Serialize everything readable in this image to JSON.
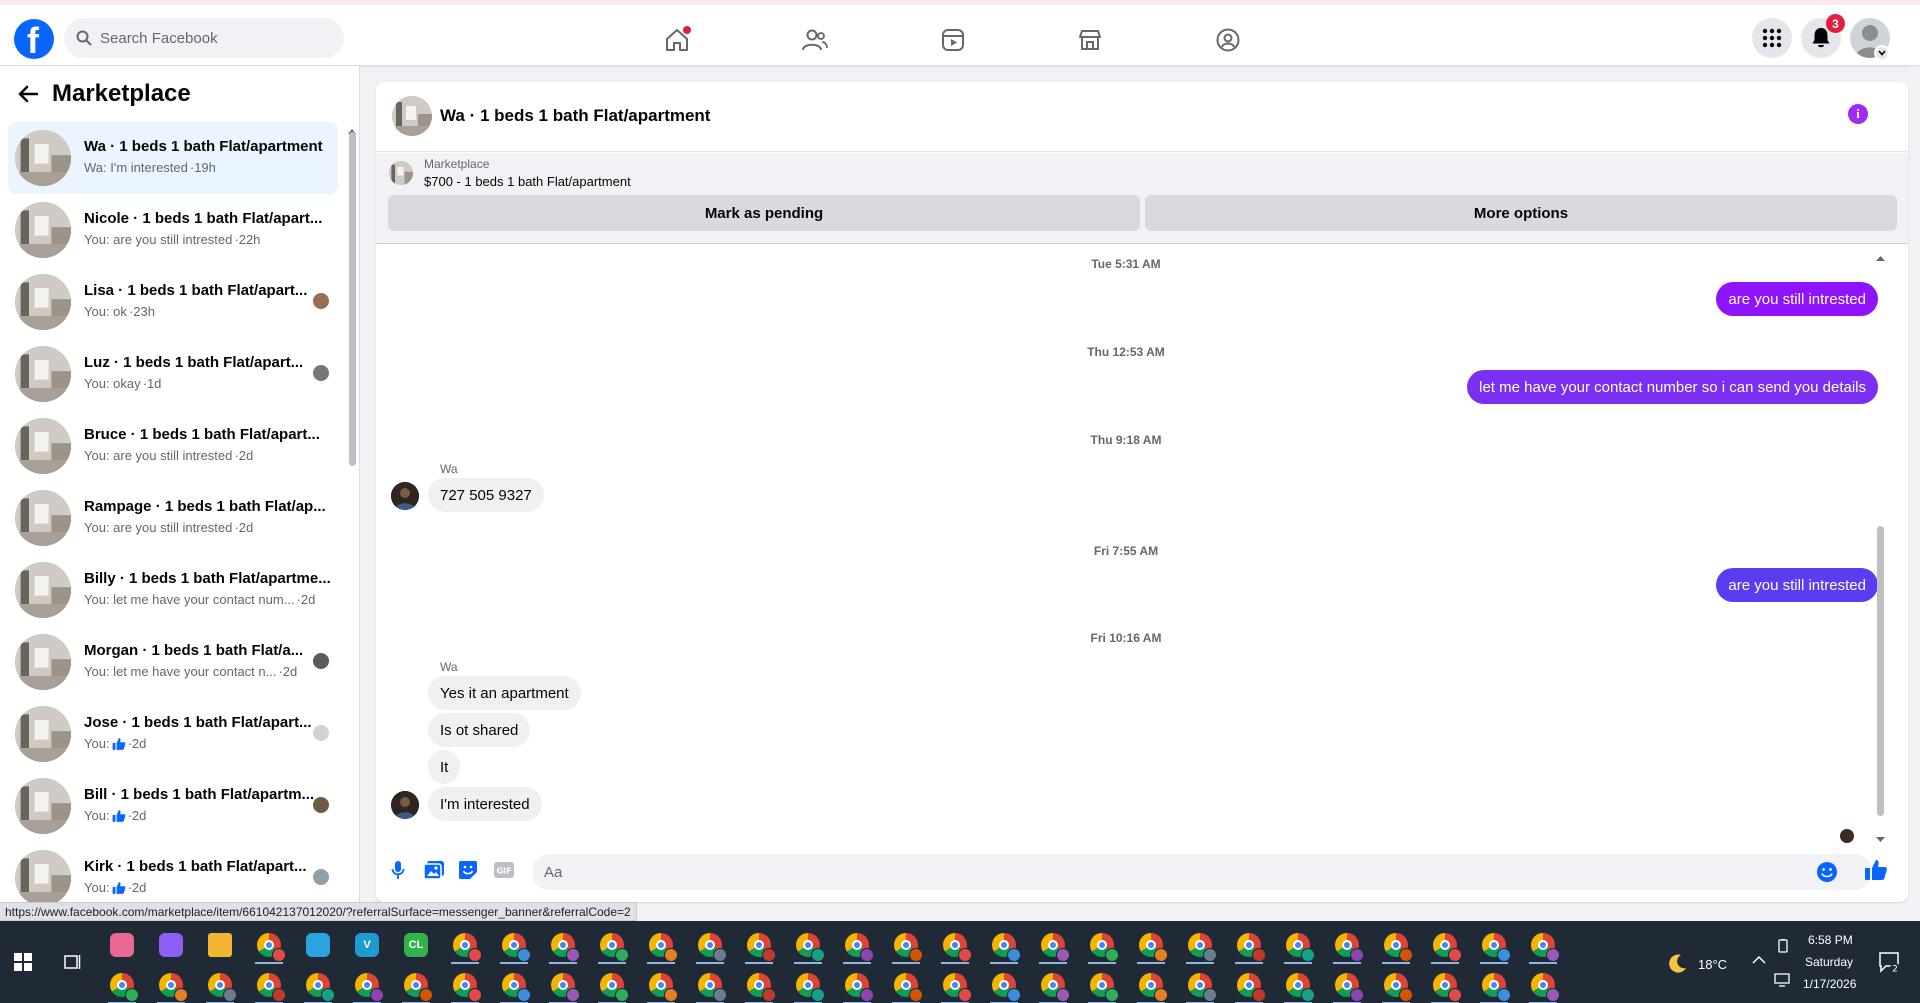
{
  "header": {
    "search_placeholder": "Search Facebook",
    "notification_count": "3"
  },
  "sidebar": {
    "title": "Marketplace",
    "conversations": [
      {
        "title": "Wa · 1 beds 1 bath Flat/apartment",
        "sub": "Wa: I'm interested",
        "time": "·19h"
      },
      {
        "title": "Nicole · 1 beds 1 bath Flat/apart...",
        "sub": "You: are you still intrested",
        "time": "·22h"
      },
      {
        "title": "Lisa · 1 beds 1 bath Flat/apart...",
        "sub": "You: ok",
        "time": "·23h"
      },
      {
        "title": "Luz · 1 beds 1 bath Flat/apart...",
        "sub": "You: okay",
        "time": "·1d"
      },
      {
        "title": "Bruce · 1 beds 1 bath Flat/apart...",
        "sub": "You: are you still intrested",
        "time": "·2d"
      },
      {
        "title": "Rampage · 1 beds 1 bath Flat/ap...",
        "sub": "You: are you still intrested",
        "time": "·2d"
      },
      {
        "title": "Billy · 1 beds 1 bath Flat/apartme...",
        "sub": "You: let me have your contact num...",
        "time": "·2d"
      },
      {
        "title": "Morgan · 1 beds 1 bath Flat/a...",
        "sub": "You: let me have your contact n...",
        "time": "·2d"
      },
      {
        "title": "Jose · 1 beds 1 bath Flat/apart...",
        "sub": "You:",
        "time": "·2d"
      },
      {
        "title": "Bill · 1 beds 1 bath Flat/apartm...",
        "sub": "You:",
        "time": "·2d"
      },
      {
        "title": "Kirk · 1 beds 1 bath Flat/apart...",
        "sub": "You:",
        "time": "·2d"
      }
    ]
  },
  "chat": {
    "title": "Wa · 1 beds 1 bath Flat/apartment",
    "marketplace_label": "Marketplace",
    "listing": "$700 - 1 beds 1 bath Flat/apartment",
    "mark_pending_label": "Mark as pending",
    "more_options_label": "More options",
    "timestamps": [
      "Tue 5:31 AM",
      "Thu 12:53 AM",
      "Thu 9:18 AM",
      "Fri 7:55 AM",
      "Fri 10:16 AM"
    ],
    "sender_name": "Wa",
    "out_messages": [
      "are you still intrested",
      "let me have your contact number so i can send you details",
      "are you still intrested"
    ],
    "in_messages": [
      "727 505 9327",
      "Yes it an apartment",
      "Is ot shared",
      "It",
      "I'm interested"
    ],
    "composer_placeholder": "Aa"
  },
  "status_url": "https://www.facebook.com/marketplace/item/661042137012020/?referralSurface=messenger_banner&referralCode=2",
  "taskbar": {
    "temperature": "18°C",
    "time": "6:58 PM",
    "day": "Saturday",
    "date": "1/17/2026",
    "notification_count": "2"
  },
  "colors": {
    "accent": "#0866ff",
    "out_bubble_purple": "#9013fe",
    "out_bubble_violet": "#7b2ff2",
    "out_bubble_blue": "#5b3cf0"
  }
}
